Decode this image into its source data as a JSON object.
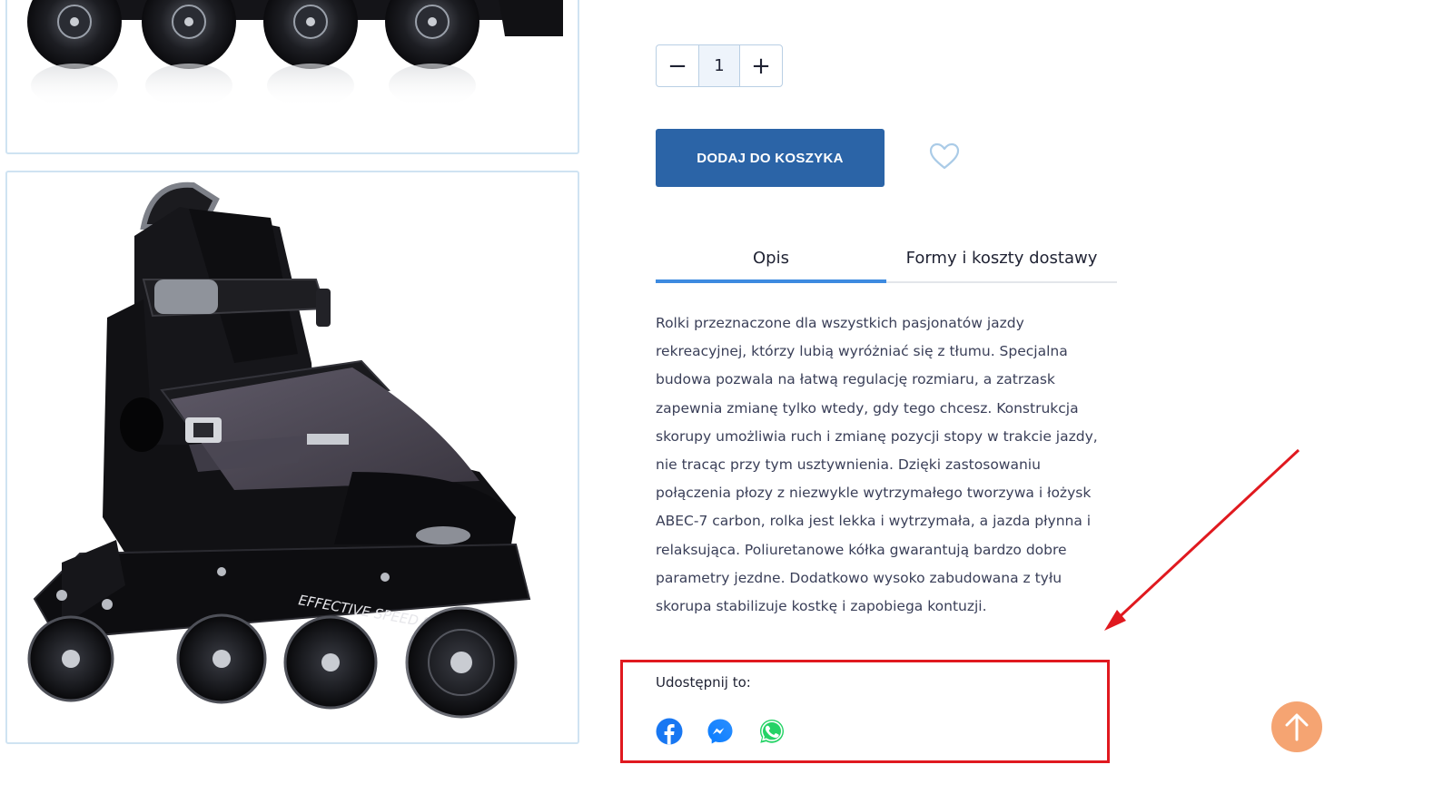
{
  "quantity": {
    "minus_symbol": "−",
    "value": "1",
    "plus_symbol": "+"
  },
  "cart": {
    "add_label": "DODAJ DO KOSZYKA"
  },
  "tabs": [
    {
      "label": "Opis",
      "active": true
    },
    {
      "label": "Formy i koszty dostawy",
      "active": false
    }
  ],
  "description": {
    "lines": [
      "Rolki przeznaczone dla wszystkich pasjonatów jazdy",
      "rekreacyjnej, którzy lubią wyróżniać się z tłumu. Specjalna",
      "budowa pozwala na łatwą regulację rozmiaru, a zatrzask",
      "zapewnia zmianę tylko wtedy, gdy tego chcesz. Konstrukcja",
      "skorupy umożliwia ruch i zmianę pozycji stopy w trakcie jazdy,",
      "nie tracąc przy tym usztywnienia. Dzięki zastosowaniu",
      "połączenia płozy z niezwykle wytrzymałego tworzywa i łożysk",
      "ABEC-7 carbon, rolka jest lekka i wytrzymała, a jazda płynna i",
      "relaksująca. Poliuretanowe kółka gwarantują bardzo dobre",
      "parametry jezdne. Dodatkowo wysoko zabudowana z tyłu",
      "skorupa stabilizuje kostkę i zapobiega kontuzji."
    ]
  },
  "share": {
    "label": "Udostępnij to:",
    "icons": [
      "facebook-icon",
      "messenger-icon",
      "whatsapp-icon"
    ]
  },
  "colors": {
    "primary_button": "#2b64a7",
    "tab_active_underline": "#3d8ae0",
    "annotation_red": "#e0191f",
    "scroll_top": "#f5a472"
  }
}
